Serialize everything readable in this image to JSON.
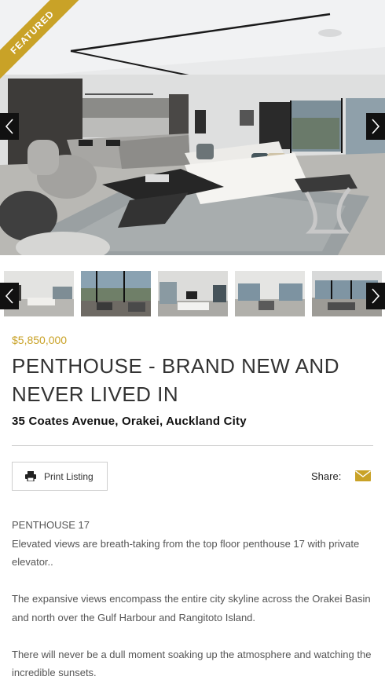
{
  "hero": {
    "badge": "FEATURED",
    "image_alt": "living-room-photo"
  },
  "listing": {
    "price": "$5,850,000",
    "title": "PENTHOUSE - BRAND NEW AND NEVER LIVED IN",
    "address": "35 Coates Avenue, Orakei, Auckland City"
  },
  "actions": {
    "print_label": "Print Listing",
    "share_label": "Share:"
  },
  "icons": {
    "prev": "chevron-left-icon",
    "next": "chevron-right-icon",
    "print": "printer-icon",
    "mail": "envelope-icon"
  },
  "colors": {
    "accent": "#c9a227",
    "arrow_bg": "#111111"
  },
  "description": {
    "subtitle": "PENTHOUSE 17",
    "paragraphs": [
      "Elevated views are breath-taking from the top floor penthouse 17 with private elevator..",
      "The expansive views encompass the entire city skyline across the Orakei Basin and north over the Gulf Harbour and Rangitoto Island.",
      "There will never be a dull moment soaking up the atmosphere and watching the incredible sunsets."
    ]
  }
}
